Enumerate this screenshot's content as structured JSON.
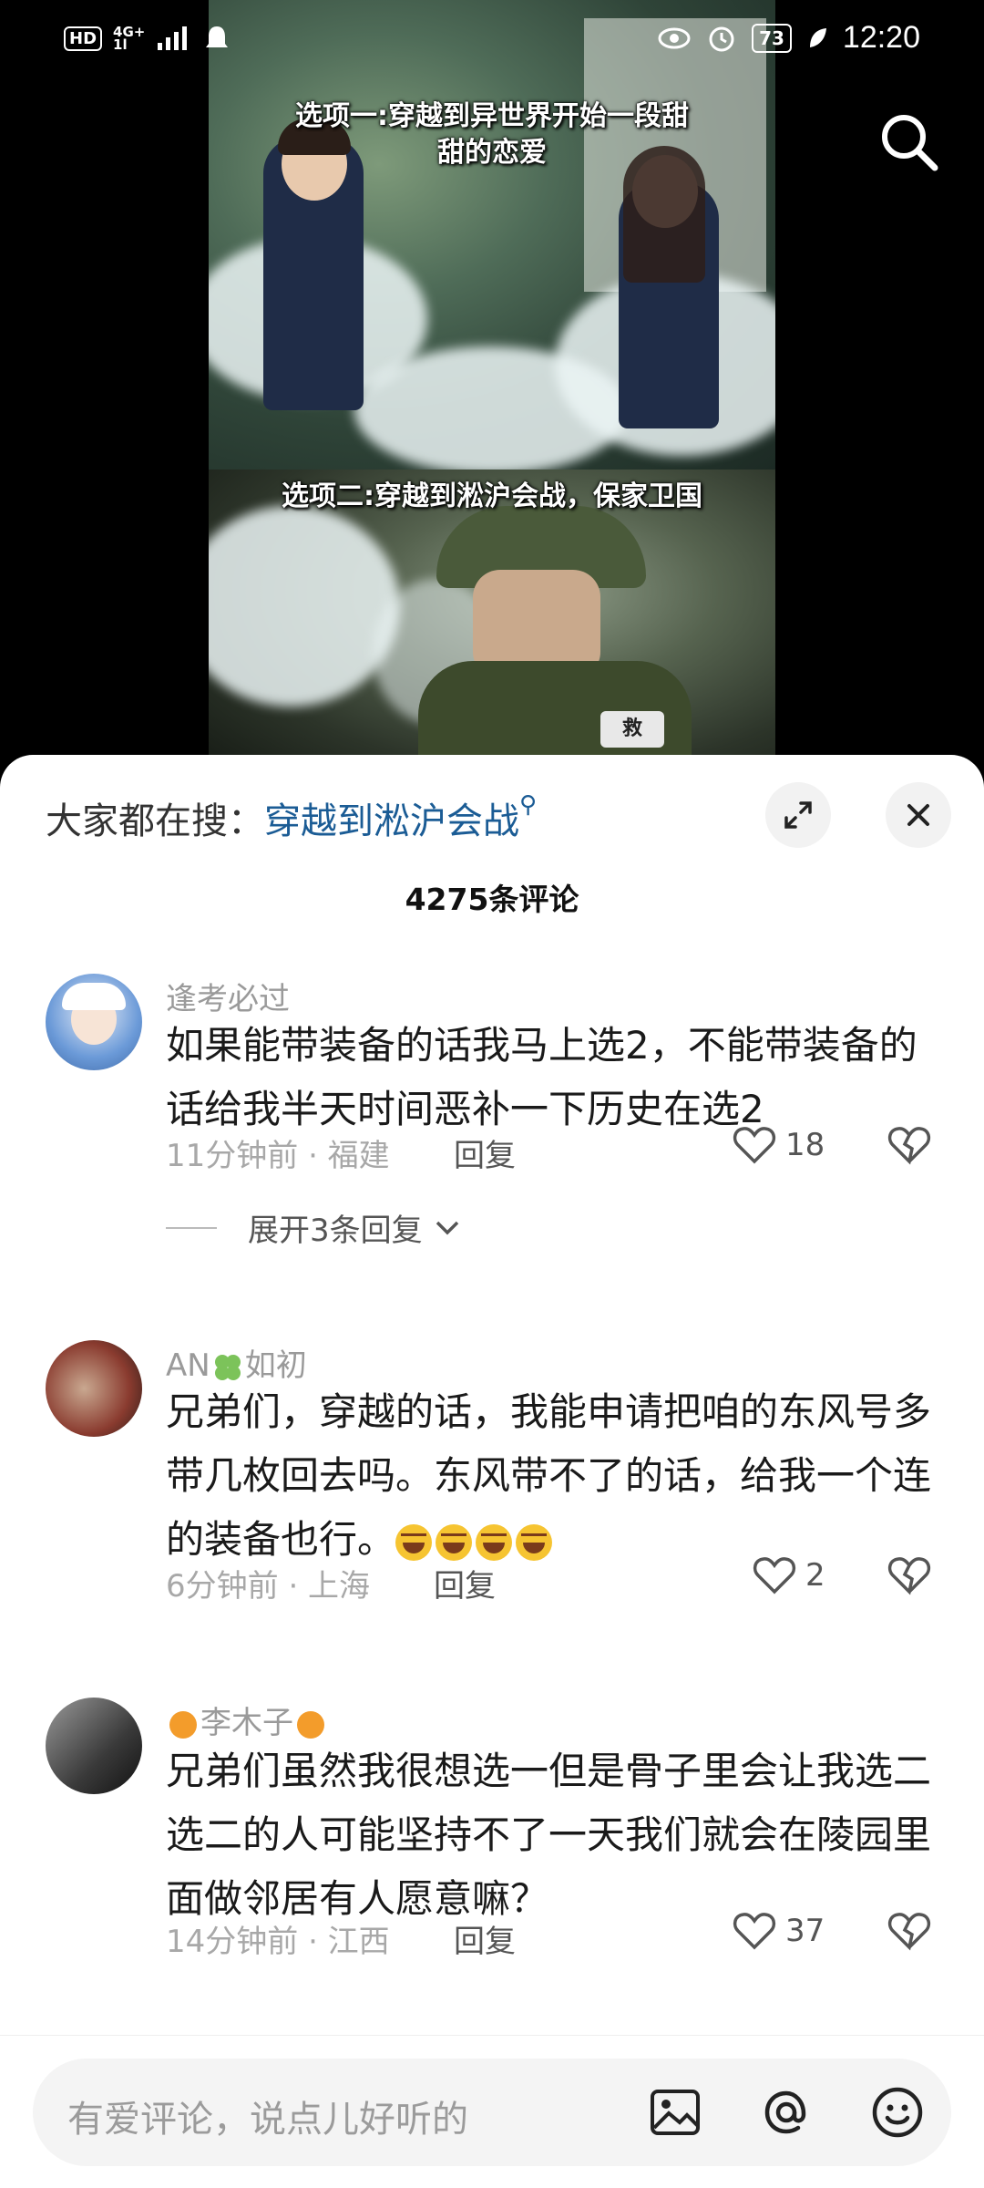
{
  "status_bar": {
    "left_badge": "HD",
    "network_top": "4G+",
    "network_bottom": "1l",
    "battery": "73",
    "time": "12:20"
  },
  "video": {
    "caption_option1_line1": "选项一:穿越到异世界开始一段甜",
    "caption_option1_line2": "甜的恋爱",
    "caption_option2": "选项二:穿越到淞沪会战，保家卫国",
    "badge_text": "救"
  },
  "top_icons": {
    "search": "search-icon"
  },
  "sheet": {
    "search_prefix": "大家都在搜：",
    "search_keyword": "穿越到淞沪会战",
    "comment_count": "4275条评论",
    "expand_icon": "expand-icon",
    "close_icon": "close-icon"
  },
  "comments": [
    {
      "name": "逢考必过",
      "text": "如果能带装备的话我马上选2，不能带装备的话给我半天时间恶补一下历史在选2",
      "time_location": "11分钟前 · 福建",
      "reply_label": "回复",
      "likes": "18",
      "expand_replies": "展开3条回复"
    },
    {
      "name_prefix": "AN",
      "name_suffix": "如初",
      "text": "兄弟们，穿越的话，我能申请把咱的东风号多带几枚回去吗。东风带不了的话，给我一个连的装备也行。",
      "time_location": "6分钟前 · 上海",
      "reply_label": "回复",
      "likes": "2"
    },
    {
      "name": "李木子",
      "text": "兄弟们虽然我很想选一但是骨子里会让我选二选二的人可能坚持不了一天我们就会在陵园里面做邻居有人愿意嘛？",
      "time_location": "14分钟前 · 江西",
      "reply_label": "回复",
      "likes": "37"
    }
  ],
  "input_bar": {
    "placeholder": "有爱评论，说点儿好听的",
    "icons": [
      "image-icon",
      "at-icon",
      "emoji-icon"
    ]
  },
  "colors": {
    "keyword_blue": "#1b5c95",
    "meta_gray": "#a8a8a8",
    "sheet_bg": "#ffffff"
  }
}
